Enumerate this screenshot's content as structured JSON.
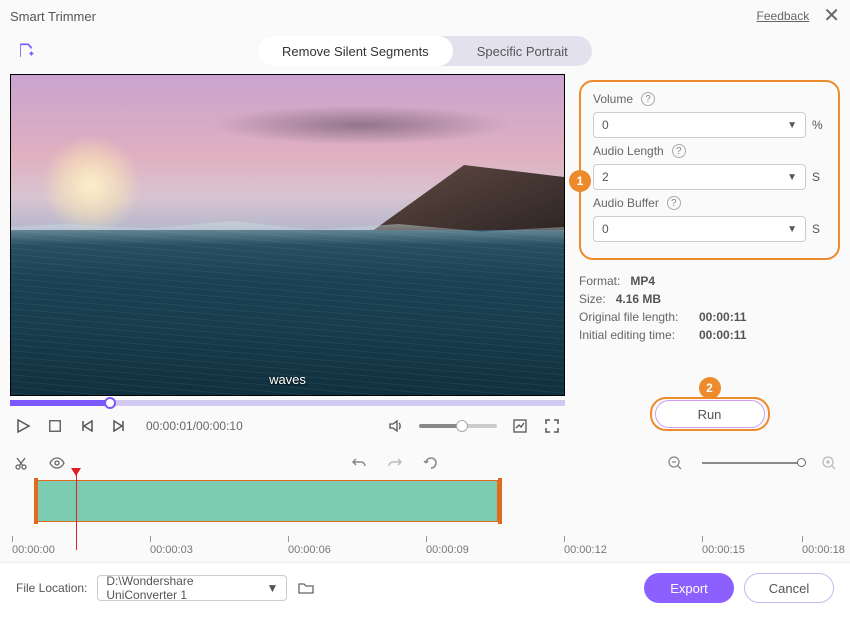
{
  "window": {
    "title": "Smart Trimmer",
    "feedback": "Feedback"
  },
  "tabs": {
    "remove_silent": "Remove Silent Segments",
    "specific_portrait": "Specific Portrait"
  },
  "preview": {
    "caption": "waves"
  },
  "playback": {
    "timecode": "00:00:01/00:00:10"
  },
  "params": {
    "volume": {
      "label": "Volume",
      "value": "0",
      "unit": "%"
    },
    "audio_length": {
      "label": "Audio Length",
      "value": "2",
      "unit": "S"
    },
    "audio_buffer": {
      "label": "Audio Buffer",
      "value": "0",
      "unit": "S"
    }
  },
  "meta": {
    "format_label": "Format:",
    "format": "MP4",
    "size_label": "Size:",
    "size": "4.16 MB",
    "original_length_label": "Original file length:",
    "original_length": "00:00:11",
    "initial_editing_label": "Initial editing time:",
    "initial_editing": "00:00:11"
  },
  "run": {
    "label": "Run"
  },
  "badges": {
    "one": "1",
    "two": "2"
  },
  "ruler": {
    "t0": "00:00:00",
    "t1": "00:00:03",
    "t2": "00:00:06",
    "t3": "00:00:09",
    "t4": "00:00:12",
    "t5": "00:00:15",
    "t6": "00:00:18"
  },
  "footer": {
    "location_label": "File Location:",
    "path": "D:\\Wondershare UniConverter 1",
    "export": "Export",
    "cancel": "Cancel"
  }
}
